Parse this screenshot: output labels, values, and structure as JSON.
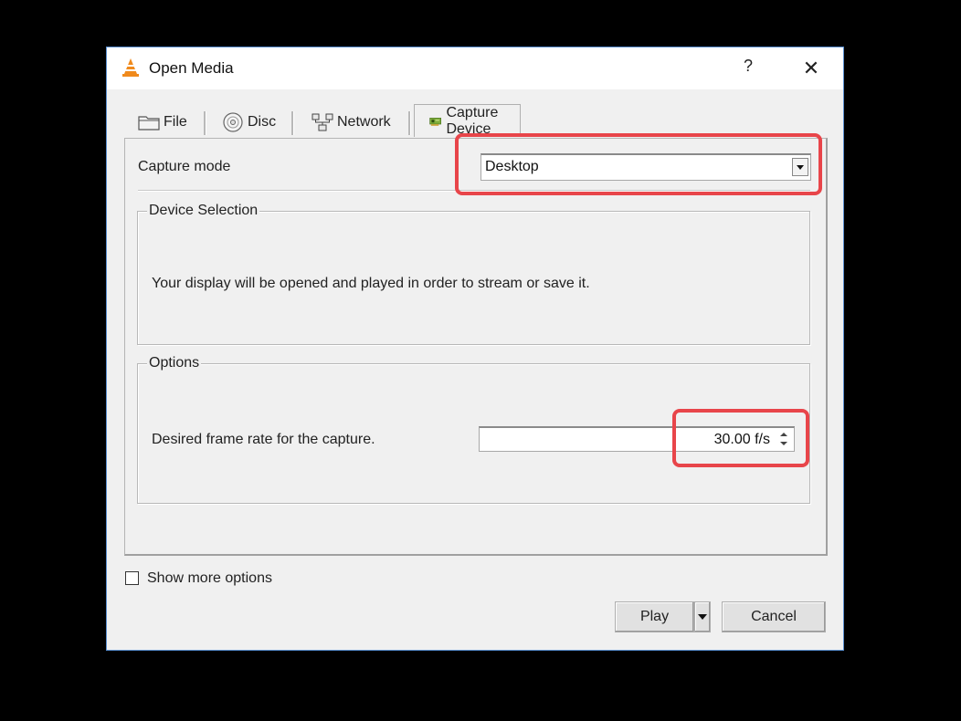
{
  "window": {
    "title": "Open Media",
    "help_label": "?",
    "close_label": "✕"
  },
  "tabs": [
    {
      "label": "File",
      "icon": "folder-icon"
    },
    {
      "label": "Disc",
      "icon": "disc-icon"
    },
    {
      "label": "Network",
      "icon": "network-icon"
    },
    {
      "label": "Capture Device",
      "icon": "capture-card-icon",
      "active": true
    }
  ],
  "capture": {
    "mode_label": "Capture mode",
    "mode_value": "Desktop"
  },
  "device_selection": {
    "title": "Device Selection",
    "text": "Your display will be opened and played in order to stream or save it."
  },
  "options": {
    "title": "Options",
    "frame_rate_label": "Desired frame rate for the capture.",
    "frame_rate_value": "30.00 f/s"
  },
  "footer": {
    "show_more_label": "Show more options",
    "show_more_checked": false,
    "play_label": "Play",
    "cancel_label": "Cancel"
  },
  "colors": {
    "highlight": "#e8454a",
    "window_border": "#5a8fd0",
    "vlc_orange": "#f08a1c"
  }
}
